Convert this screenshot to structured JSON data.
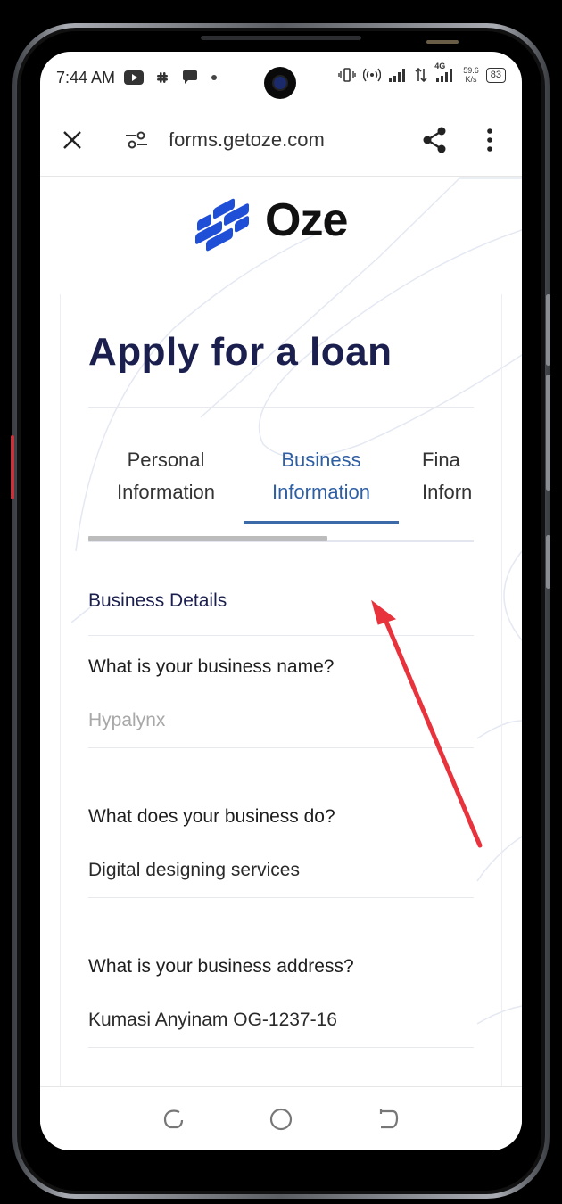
{
  "status_bar": {
    "time": "7:44 AM",
    "net_speed_value": "59.6",
    "net_speed_unit": "K/s",
    "network_type": "4G",
    "battery": "83"
  },
  "browser": {
    "url": "forms.getoze.com"
  },
  "brand": {
    "name": "Oze",
    "accent_color": "#1f4fd6"
  },
  "form": {
    "title": "Apply for a loan",
    "tabs": [
      {
        "line1": "Personal",
        "line2": "Information"
      },
      {
        "line1": "Business",
        "line2": "Information"
      },
      {
        "line1": "Fina",
        "line2": "Inforn"
      }
    ],
    "active_tab": 1,
    "section_title": "Business Details",
    "questions": [
      {
        "label": "What is your business name?",
        "value": "",
        "placeholder": "Hypalynx"
      },
      {
        "label": "What does your business do?",
        "value": "Digital designing services"
      },
      {
        "label": "What is your business address?",
        "value": "Kumasi Anyinam OG-1237-16"
      }
    ]
  },
  "annotation": {
    "arrow_color": "#e8323c"
  }
}
